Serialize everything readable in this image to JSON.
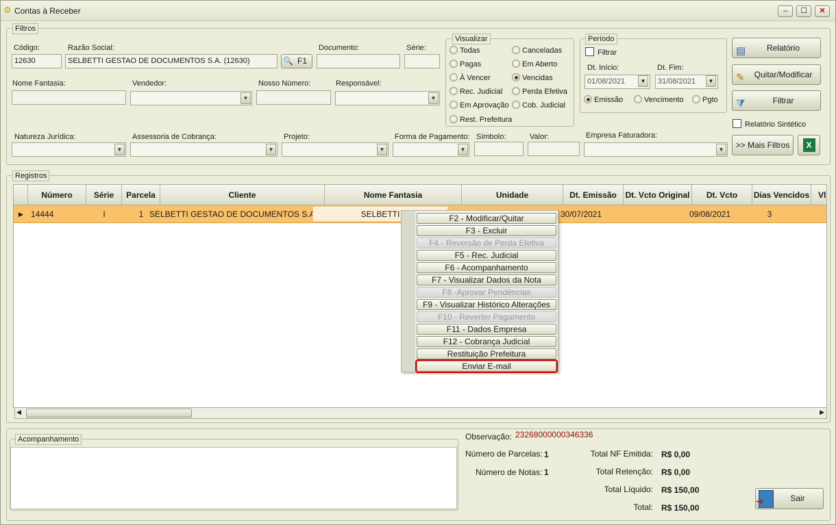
{
  "window": {
    "title": "Contas à Receber",
    "min": "–",
    "max": "☐",
    "close": "✕"
  },
  "filtros": {
    "label": "Filtros",
    "codigo_label": "Código:",
    "codigo_value": "12630",
    "razao_label": "Razão Social:",
    "razao_value": "SELBETTI GESTAO DE DOCUMENTOS S.A. (12630)",
    "f1_label": "F1",
    "documento_label": "Documento:",
    "serie_label": "Série:",
    "fantasia_label": "Nome Fantasia:",
    "vendedor_label": "Vendedor:",
    "nosso_label": "Nosso Número:",
    "responsavel_label": "Responsável:",
    "natureza_label": "Natureza Jurídica:",
    "assessoria_label": "Assessoria de Cobrança:",
    "projeto_label": "Projeto:",
    "forma_label": "Forma de Pagamento:",
    "simbolo_label": "Símbolo:",
    "valor_label": "Valor:",
    "empresa_label": "Empresa Faturadora:"
  },
  "visualizar": {
    "label": "Visualizar",
    "options": [
      "Todas",
      "Canceladas",
      "Pagas",
      "Em Aberto",
      "À Vencer",
      "Vencidas",
      "Rec. Judicial",
      "Perda Efetiva",
      "Em Aprovação",
      "Cob. Judicial",
      "Rest. Prefeitura"
    ],
    "selected": "Vencidas"
  },
  "periodo": {
    "label": "Período",
    "filtrar": "Filtrar",
    "inicio_label": "Dt. Início:",
    "inicio_value": "01/08/2021",
    "fim_label": "Dt. Fim:",
    "fim_value": "31/08/2021",
    "options": [
      "Emissão",
      "Vencimento",
      "Pgto"
    ],
    "selected": "Emissão"
  },
  "buttons": {
    "relatorio": "Relatório",
    "quitar": "Quitar/Modificar",
    "filtrar": "Filtrar",
    "sintetico": "Relatório Sintético",
    "mais_filtros": ">> Mais Filtros",
    "sair": "Sair"
  },
  "registros": {
    "label": "Registros",
    "columns": [
      "Número",
      "Série",
      "Parcela",
      "Cliente",
      "Nome Fantasia",
      "Unidade",
      "Dt. Emissão",
      "Dt. Vcto Original",
      "Dt. Vcto",
      "Dias Vencidos",
      "Vl. To"
    ],
    "row": {
      "numero": "14444",
      "serie": "I",
      "parcela": "1",
      "cliente": "SELBETTI GESTAO DE DOCUMENTOS S.A..",
      "fantasia": "SELBETTI",
      "emissao": "30/07/2021",
      "vcto": "09/08/2021",
      "dias": "3"
    }
  },
  "context_menu": {
    "items": [
      "F2 - Modificar/Quitar",
      "F3 - Excluir",
      "F4 - Reversão de Perda Efetiva",
      "F5 - Rec. Judicial",
      "F6 - Acompanhamento",
      "F7 - Visualizar Dados da Nota",
      "F8 -Aprovar Pendências",
      "F9 - Visualizar Histórico Alterações",
      "F10 - Reverter Pagamento",
      "F11 - Dados Empresa",
      "F12 - Cobrança Judicial",
      "Restituição Prefeitura",
      "Enviar E-mail"
    ],
    "disabled": [
      2,
      6,
      8
    ],
    "highlighted": 12
  },
  "acompanhamento": {
    "label": "Acompanhamento"
  },
  "resumo": {
    "observacao_label": "Observação:",
    "observacao_value": "23268000000346336",
    "parcelas_label": "Número de Parcelas:",
    "parcelas_value": "1",
    "notas_label": "Número de Notas:",
    "notas_value": "1",
    "nf_label": "Total NF Emitida:",
    "nf_value": "R$ 0,00",
    "retencao_label": "Total Retenção:",
    "retencao_value": "R$ 0,00",
    "liquido_label": "Total Líquido:",
    "liquido_value": "R$ 150,00",
    "total_label": "Total:",
    "total_value": "R$ 150,00"
  },
  "colors": {
    "selected_row": "#f9c26a",
    "highlight_border": "#e00000",
    "observacao_text": "#8b1010"
  }
}
